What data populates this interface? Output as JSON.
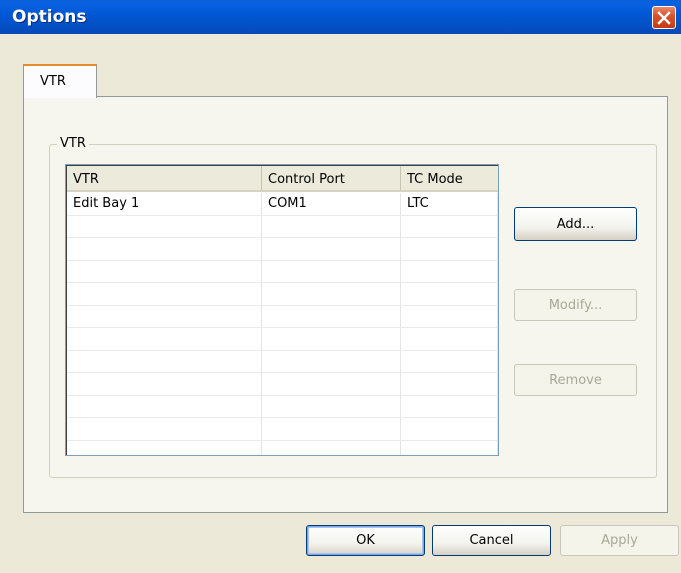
{
  "window": {
    "title": "Options"
  },
  "tabs": [
    {
      "label": "VTR"
    }
  ],
  "group": {
    "label": "VTR"
  },
  "list": {
    "columns": [
      "VTR",
      "Control Port",
      "TC Mode"
    ],
    "rows": [
      [
        "Edit Bay 1",
        "COM1",
        "LTC"
      ]
    ]
  },
  "side_buttons": {
    "add": "Add...",
    "modify": "Modify...",
    "remove": "Remove"
  },
  "footer_buttons": {
    "ok": "OK",
    "cancel": "Cancel",
    "apply": "Apply"
  },
  "colors": {
    "titlebar": "#0058d6",
    "close_button": "#d8532c",
    "tab_highlight": "#e68b2c"
  },
  "icons": {
    "close": "close-icon"
  }
}
